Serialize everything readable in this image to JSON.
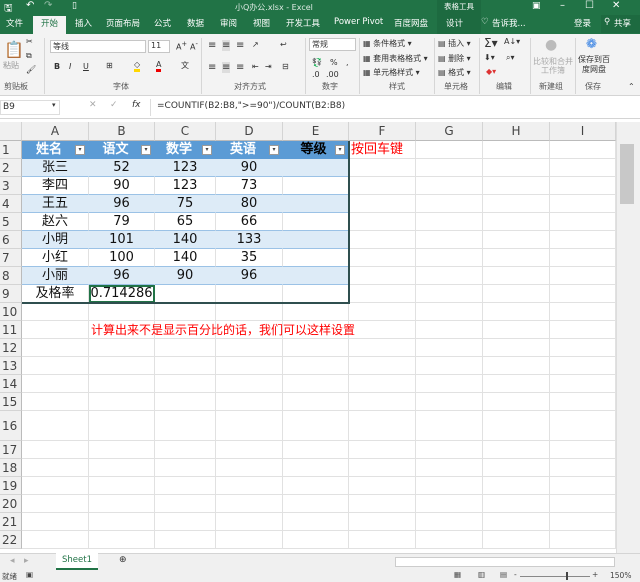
{
  "title": "小Q办公.xlsx - Excel",
  "contextual_tab": "表格工具",
  "quick_access": {
    "save": "save-icon",
    "undo": "undo-icon",
    "redo": "redo-icon"
  },
  "tabs": [
    "文件",
    "开始",
    "插入",
    "页面布局",
    "公式",
    "数据",
    "审阅",
    "视图",
    "开发工具",
    "Power Pivot",
    "百度网盘",
    "设计"
  ],
  "active_tab": "开始",
  "tell_me": "告诉我...",
  "login": "登录",
  "share": "共享",
  "ribbon": {
    "paste": "粘贴",
    "font_name": "等线",
    "font_size": "11",
    "number_format": "常规",
    "cond_format": "条件格式",
    "table_format": "套用表格格式",
    "cell_style": "单元格样式",
    "insert": "插入",
    "delete": "删除",
    "format": "格式",
    "compare": "比较和合并工作簿",
    "save_baidu": "保存到百度网盘",
    "groups": [
      "剪贴板",
      "字体",
      "对齐方式",
      "数字",
      "样式",
      "单元格",
      "编辑",
      "新建组",
      "保存"
    ]
  },
  "name_box": "B9",
  "formula": "=COUNTIF(B2:B8,\">=90\")/COUNT(B2:B8)",
  "columns": [
    "A",
    "B",
    "C",
    "D",
    "E",
    "F",
    "G",
    "H",
    "I"
  ],
  "row_numbers": [
    "1",
    "2",
    "3",
    "4",
    "5",
    "6",
    "7",
    "8",
    "9",
    "10",
    "11",
    "12",
    "13",
    "14",
    "15",
    "16",
    "17",
    "18",
    "19",
    "20",
    "21",
    "22"
  ],
  "table": {
    "headers": [
      "姓名",
      "语文",
      "数学",
      "英语",
      "等级"
    ],
    "rows": [
      [
        "张三",
        "52",
        "123",
        "90",
        ""
      ],
      [
        "李四",
        "90",
        "123",
        "73",
        ""
      ],
      [
        "王五",
        "96",
        "75",
        "80",
        ""
      ],
      [
        "赵六",
        "79",
        "65",
        "66",
        ""
      ],
      [
        "小明",
        "101",
        "140",
        "133",
        ""
      ],
      [
        "小红",
        "100",
        "140",
        "35",
        ""
      ],
      [
        "小丽",
        "96",
        "90",
        "96",
        ""
      ]
    ],
    "total_label": "及格率",
    "total_value": "0.714286"
  },
  "note_f1": "按回车键",
  "note_b11": "计算出来不是显示百分比的话，我们可以这样设置",
  "sheet_tab": "Sheet1",
  "status": "就绪",
  "zoom": "150%",
  "colors": {
    "green": "#217346",
    "header": "#5b9bd5",
    "band": "#ddebf7",
    "note": "#ff0000"
  }
}
